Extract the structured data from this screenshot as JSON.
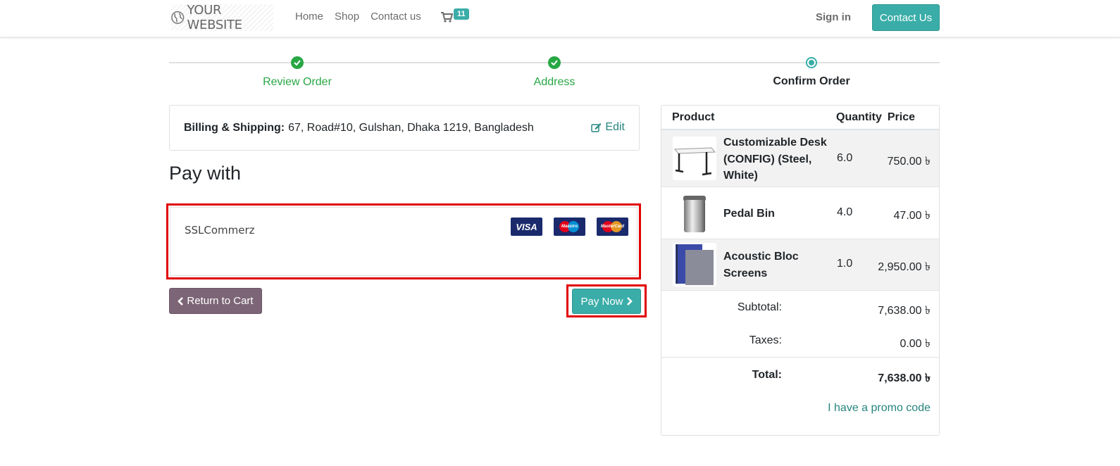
{
  "header": {
    "logo_text": "YOUR WEBSITE",
    "nav": [
      "Home",
      "Shop",
      "Contact us"
    ],
    "cart_count": "11",
    "signin": "Sign in",
    "contact_button": "Contact Us"
  },
  "steps": [
    {
      "label": "Review Order",
      "state": "done"
    },
    {
      "label": "Address",
      "state": "done"
    },
    {
      "label": "Confirm Order",
      "state": "current"
    }
  ],
  "billing": {
    "label": "Billing & Shipping:",
    "address": "67, Road#10, Gulshan, Dhaka 1219, Bangladesh",
    "edit": "Edit"
  },
  "payment": {
    "heading": "Pay with",
    "provider": "SSLCommerz",
    "cards": [
      "VISA",
      "Maestro",
      "MasterCard"
    ],
    "return_button": "Return to Cart",
    "pay_button": "Pay Now"
  },
  "summary": {
    "columns": [
      "Product",
      "Quantity",
      "Price"
    ],
    "items": [
      {
        "name": "Customizable Desk (CONFIG) (Steel, White)",
        "qty": "6.0",
        "price": "750.00 ৳"
      },
      {
        "name": "Pedal Bin",
        "qty": "4.0",
        "price": "47.00 ৳"
      },
      {
        "name": "Acoustic Bloc Screens",
        "qty": "1.0",
        "price": "2,950.00 ৳"
      }
    ],
    "subtotal_label": "Subtotal:",
    "subtotal": "7,638.00 ৳",
    "taxes_label": "Taxes:",
    "taxes": "0.00 ৳",
    "total_label": "Total:",
    "total": "7,638.00 ৳",
    "promo": "I have a promo code"
  },
  "colors": {
    "accent": "#3aada8",
    "success": "#28a745",
    "highlight": "#e10000",
    "secondary_button": "#7c6576"
  }
}
